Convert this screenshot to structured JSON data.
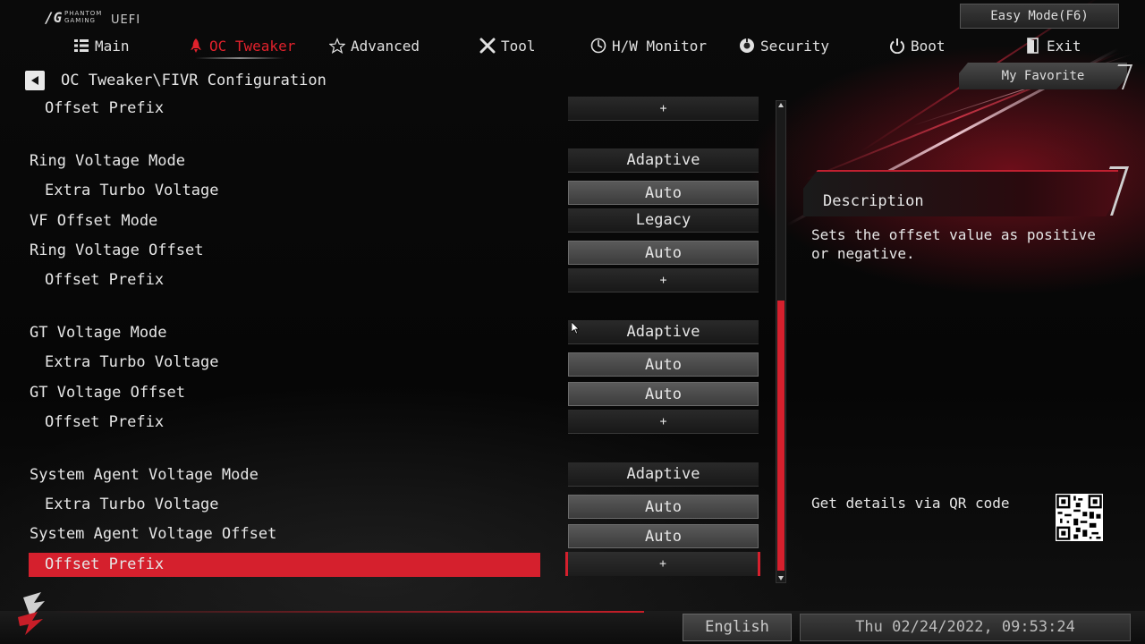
{
  "header": {
    "logo_brand": "PHANTOM GAMING",
    "logo_uefi": "UEFI",
    "easy_mode_label": "Easy Mode(F6)"
  },
  "nav": {
    "items": [
      {
        "label": "Main",
        "icon": "list-icon"
      },
      {
        "label": "OC Tweaker",
        "icon": "rocket-icon",
        "active": true
      },
      {
        "label": "Advanced",
        "icon": "star-icon"
      },
      {
        "label": "Tool",
        "icon": "tools-icon"
      },
      {
        "label": "H/W Monitor",
        "icon": "monitor-icon"
      },
      {
        "label": "Security",
        "icon": "shield-icon"
      },
      {
        "label": "Boot",
        "icon": "power-icon"
      },
      {
        "label": "Exit",
        "icon": "exit-icon"
      }
    ]
  },
  "breadcrumb": "OC Tweaker\\FIVR Configuration",
  "favorite_label": "My Favorite",
  "settings": [
    {
      "label": "Offset Prefix",
      "value": "+"
    },
    {
      "label": "Ring Voltage Mode",
      "value": "Adaptive"
    },
    {
      "label": "Extra Turbo Voltage",
      "value": "Auto"
    },
    {
      "label": "VF Offset Mode",
      "value": "Legacy"
    },
    {
      "label": "Ring Voltage Offset",
      "value": "Auto"
    },
    {
      "label": "Offset Prefix",
      "value": "+"
    },
    {
      "label": "GT Voltage Mode",
      "value": "Adaptive"
    },
    {
      "label": "Extra Turbo Voltage",
      "value": "Auto"
    },
    {
      "label": "GT Voltage Offset",
      "value": "Auto"
    },
    {
      "label": "Offset Prefix",
      "value": "+"
    },
    {
      "label": "System Agent Voltage Mode",
      "value": "Adaptive"
    },
    {
      "label": "Extra Turbo Voltage",
      "value": "Auto"
    },
    {
      "label": "System Agent Voltage Offset",
      "value": "Auto"
    },
    {
      "label": "Offset Prefix",
      "value": "+",
      "selected": true
    }
  ],
  "description": {
    "title": "Description",
    "text": "Sets the offset value as positive or negative."
  },
  "qr_label": "Get details via QR code",
  "footer": {
    "language": "English",
    "datetime": "Thu 02/24/2022, 09:53:24"
  },
  "colors": {
    "accent": "#d5202d",
    "text": "#e6e6e6"
  }
}
